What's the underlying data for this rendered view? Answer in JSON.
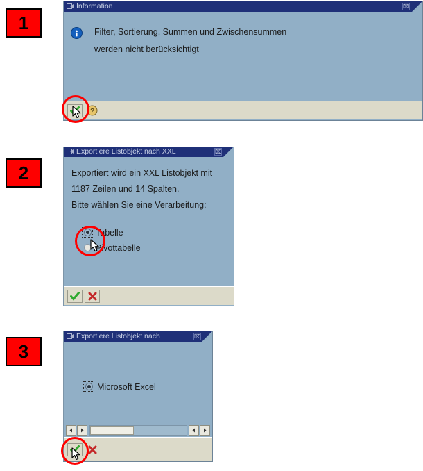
{
  "steps": [
    {
      "badge": "1"
    },
    {
      "badge": "2"
    },
    {
      "badge": "3"
    }
  ],
  "dialog1": {
    "title": "Information",
    "close_label": "⌧",
    "icon": "info-icon",
    "message_lines": [
      "Filter, Sortierung, Summen und Zwischensummen",
      "werden nicht berücksichtigt"
    ],
    "buttons": [
      {
        "name": "continue-button",
        "glyph": "check"
      },
      {
        "name": "help-button",
        "glyph": "help"
      }
    ]
  },
  "dialog2": {
    "title": "Exportiere Listobjekt nach XXL",
    "close_label": "⌧",
    "message_lines": [
      "Exportiert wird ein XXL Listobjekt mit",
      "1187 Zeilen und 14 Spalten.",
      "Bitte wählen Sie eine Verarbeitung:"
    ],
    "rows_count": "1187",
    "columns_count": "14",
    "options": [
      {
        "label": "Tabelle",
        "selected": true
      },
      {
        "label": "Pivottabelle",
        "selected": false
      }
    ],
    "buttons": [
      {
        "name": "confirm-button",
        "glyph": "check"
      },
      {
        "name": "cancel-button",
        "glyph": "cross"
      }
    ]
  },
  "dialog3": {
    "title": "Exportiere Listobjekt nach",
    "close_label": "⌧",
    "options": [
      {
        "label": "Microsoft Excel",
        "selected": true
      }
    ],
    "scrollbar": {
      "left_arrow": "◀",
      "right_arrow": "▶",
      "thumb_percent": 45
    },
    "buttons": [
      {
        "name": "confirm-button",
        "glyph": "check"
      },
      {
        "name": "cancel-button",
        "glyph": "cross"
      }
    ]
  },
  "colors": {
    "badge_bg": "#fe0000",
    "annotation": "#fe0000",
    "titlebar": "#1f3078",
    "dialog_body": "#91afc6",
    "footer": "#dcdac9",
    "check_green": "#2faa2f",
    "cross_red": "#c32828"
  }
}
